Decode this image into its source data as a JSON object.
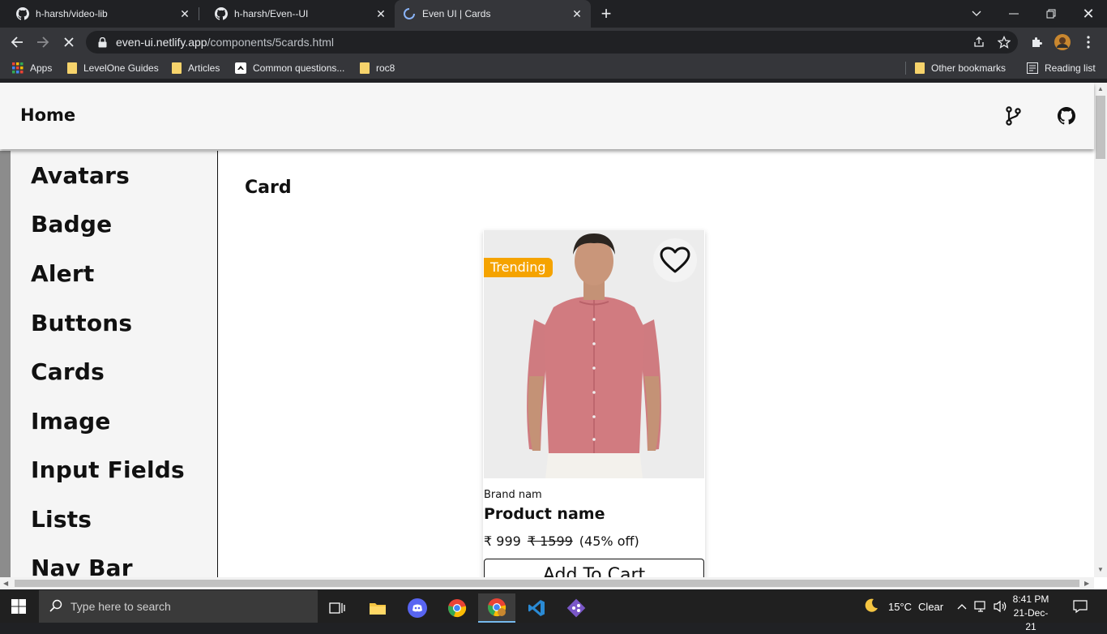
{
  "browser": {
    "tabs": [
      {
        "title": "h-harsh/video-lib",
        "icon": "github-icon"
      },
      {
        "title": "h-harsh/Even--UI",
        "icon": "github-icon"
      },
      {
        "title": "Even UI | Cards",
        "icon": "loading-spinner-icon",
        "active": true
      }
    ],
    "url_host": "even-ui.netlify.app",
    "url_path": "/components/5cards.html",
    "bookmarks": [
      "Apps",
      "LevelOne Guides",
      "Articles",
      "Common questions...",
      "roc8"
    ],
    "bookmarks_right": [
      "Other bookmarks",
      "Reading list"
    ]
  },
  "page": {
    "home_label": "Home",
    "sidebar": [
      "Avatars",
      "Badge",
      "Alert",
      "Buttons",
      "Cards",
      "Image",
      "Input Fields",
      "Lists",
      "Nav Bar"
    ],
    "section_title": "Card",
    "card": {
      "badge": "Trending",
      "brand": "Brand nam",
      "product_name": "Product name",
      "price": "₹ 999",
      "old_price": "₹ 1599",
      "discount": "(45% off)",
      "cta": "Add To Cart"
    }
  },
  "taskbar": {
    "search_placeholder": "Type here to search",
    "weather_temp": "15°C",
    "weather_desc": "Clear",
    "time": "8:41 PM",
    "date": "21-Dec-21"
  },
  "colors": {
    "badge": "#f5a300",
    "shirt": "#d17b80",
    "chrome_dark": "#202124",
    "chrome_mid": "#35363a"
  }
}
